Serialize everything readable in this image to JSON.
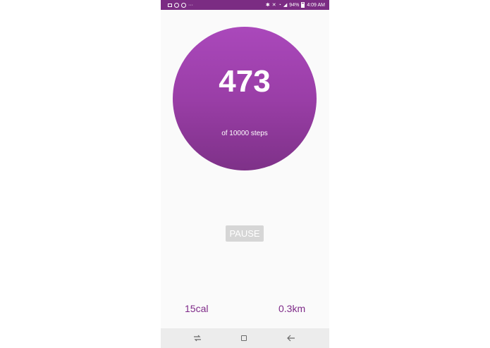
{
  "status_bar": {
    "notification_icons": [
      "image-icon",
      "circle-icon",
      "circle-icon"
    ],
    "overflow": "···",
    "battery_percent": "94%",
    "time": "4:09 AM",
    "bg_color": "#7b2c83"
  },
  "steps": {
    "count": "473",
    "goal_text": "of 10000 steps",
    "circle_color": "#9a3ea7"
  },
  "controls": {
    "pause_label": "PAUSE"
  },
  "stats": {
    "calories": "15cal",
    "distance": "0.3km",
    "text_color": "#7e2a88"
  },
  "nav_bar": {
    "recent_icon": "recent-apps-icon",
    "home_icon": "home-icon",
    "back_icon": "back-icon"
  }
}
